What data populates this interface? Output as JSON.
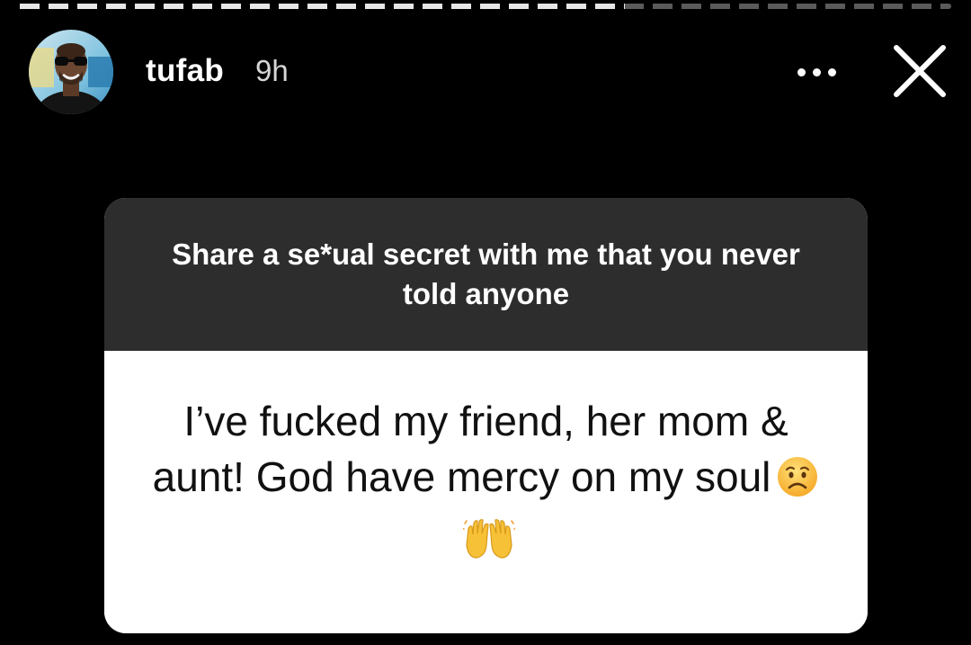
{
  "story": {
    "progress_fraction": 0.65,
    "header": {
      "username": "tufab",
      "timestamp": "9h",
      "more_icon": "more-horizontal-icon",
      "close_icon": "close-icon"
    }
  },
  "question_sticker": {
    "question": "Share a se*ual secret with me that you never told anyone",
    "answer": "I’ve fucked my friend, her mom & aunt!  God have mercy on my soul",
    "answer_emojis": [
      "worried-face-icon",
      "raised-hands-icon"
    ]
  },
  "colors": {
    "background": "#000000",
    "question_bg": "#2d2d2d",
    "answer_bg": "#ffffff",
    "text_light": "#ffffff",
    "text_dark": "#111111"
  }
}
